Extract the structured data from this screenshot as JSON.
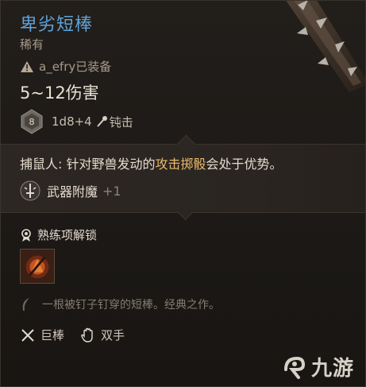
{
  "item": {
    "name": "卑劣短棒",
    "rarity": "稀有",
    "equipped_text": "a_efry已装备",
    "damage": "5~12伤害",
    "dice_face": "8",
    "dice_formula": "1d8+4",
    "damage_type": "钝击"
  },
  "passive": {
    "name": "捕鼠人: ",
    "text_a": "针对野兽发动的",
    "highlight": "攻击掷骰",
    "text_b": "会处于优势。"
  },
  "enchant": {
    "label": "武器附魔",
    "value": "+1"
  },
  "proficiency": {
    "label": "熟练项解锁"
  },
  "flavor": "一根被钉子钉穿的短棒。经典之作。",
  "properties": [
    {
      "label": "巨棒",
      "icon": "crossed-weapons-icon"
    },
    {
      "label": "双手",
      "icon": "hand-icon"
    }
  ],
  "watermark": {
    "text": "九游",
    "icon": "jiuyou-logo-icon"
  },
  "colors": {
    "title": "#5fa3d9",
    "highlight": "#e9b96a",
    "background": "#1c1916"
  }
}
